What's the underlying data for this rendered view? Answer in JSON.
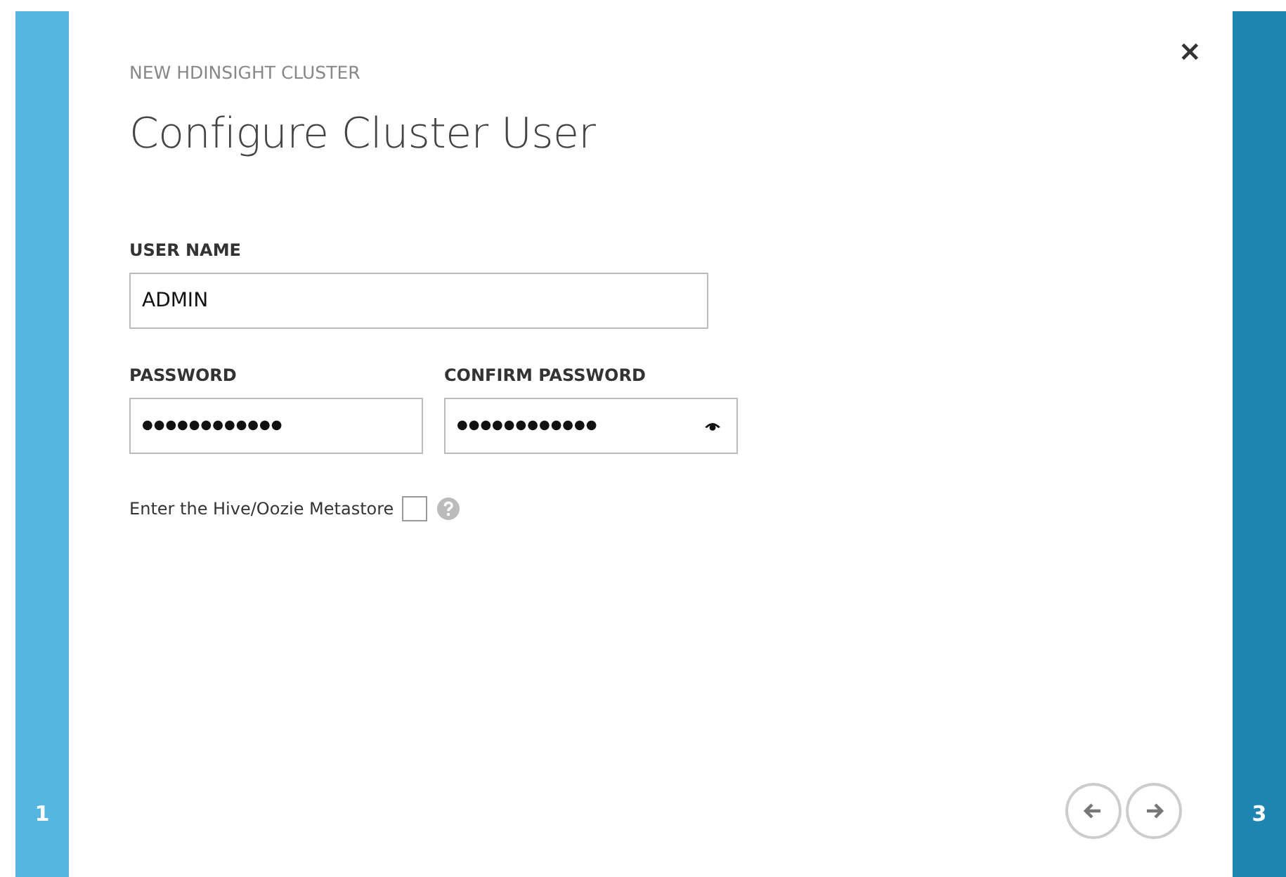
{
  "steps": [
    {
      "label": "1",
      "kind": "previous"
    },
    {
      "label": "3",
      "kind": "next"
    }
  ],
  "dialog": {
    "subtitle": "NEW HDINSIGHT CLUSTER",
    "title": "Configure Cluster User",
    "close": "×"
  },
  "fields": [
    {
      "label": "USER NAME",
      "value": "ADMIN",
      "kind": "text"
    },
    {
      "label": "PASSWORD",
      "value": "●●●●●●●●●●●●",
      "kind": "password"
    },
    {
      "label": "CONFIRM PASSWORD",
      "value": "●●●●●●●●●●●●",
      "kind": "reveal"
    }
  ],
  "metastore": {
    "label": "Enter the Hive/Oozie Metastore",
    "checked": false
  },
  "nav": [
    {
      "kind": "back"
    },
    {
      "kind": "forward"
    }
  ]
}
